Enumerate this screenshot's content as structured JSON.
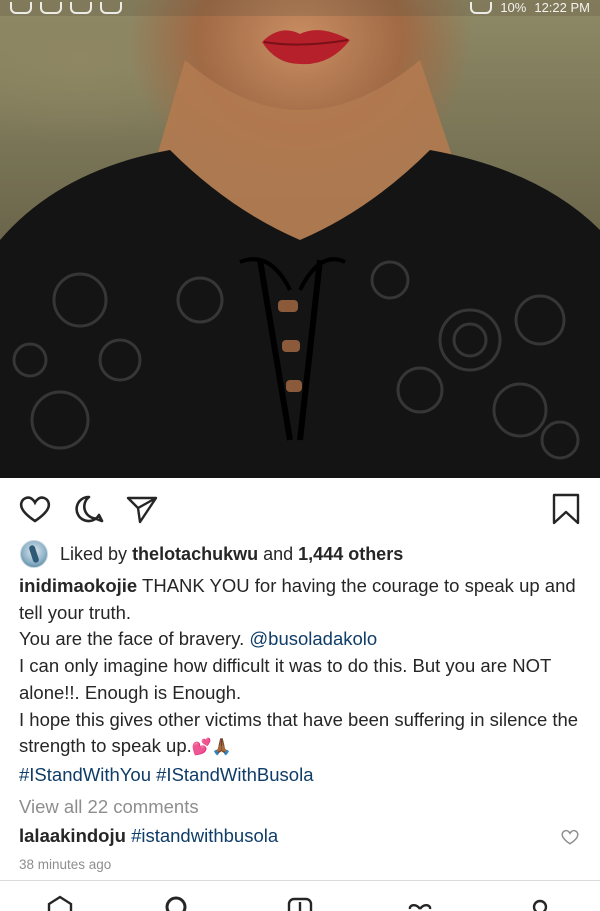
{
  "status_bar": {
    "battery": "10%",
    "time": "12:22 PM"
  },
  "post": {
    "image_alt": "portrait-photo",
    "liked_by_prefix": "Liked by",
    "liked_by_user": "thelotachukwu",
    "liked_by_and": "and",
    "liked_by_others": "1,444 others",
    "caption_user": "inidimaokojie",
    "caption_line1": "THANK YOU for having the courage to speak up and tell your truth.",
    "caption_line2_text": "You are the face of bravery.",
    "caption_line2_mention": "@busoladakolo",
    "caption_line3": "I can only imagine how difficult it was to do this. But you are NOT alone!!. Enough is Enough.",
    "caption_line4": "I hope this gives other victims that have been suffering in silence the strength to speak up.",
    "caption_emojis": "💕🙏🏾",
    "hashtag1": "#IStandWithYou",
    "hashtag2": "#IStandWithBusola",
    "view_comments": "View all 22 comments",
    "comment_user": "lalaakindoju",
    "comment_text": "#istandwithbusola",
    "timestamp": "38 minutes ago"
  },
  "icons": {
    "like": "heart-icon",
    "comment": "comment-icon",
    "share": "send-icon",
    "save": "bookmark-icon",
    "comment_like": "small-heart-icon",
    "nav": [
      "home-icon",
      "search-icon",
      "add-post-icon",
      "activity-icon",
      "profile-icon"
    ]
  },
  "colors": {
    "text": "#262626",
    "muted": "#8e8e8e",
    "link": "#0f3d68",
    "lipstick": "#b5202a"
  }
}
